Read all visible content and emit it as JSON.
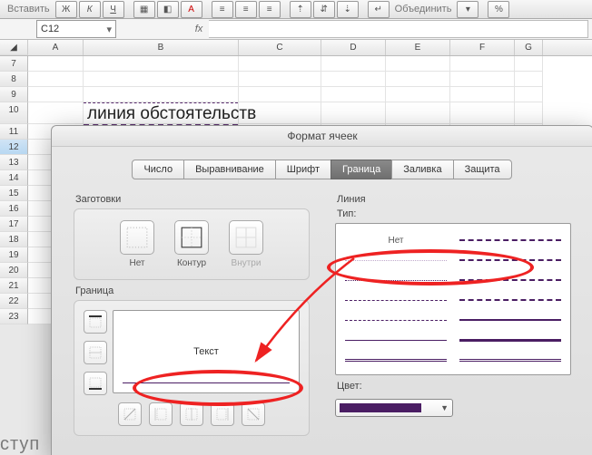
{
  "toolbar": {
    "insert_label": "Вставить",
    "merge_label": "Объединить"
  },
  "formula_bar": {
    "cell_ref": "C12",
    "fx_label": "fx"
  },
  "columns": [
    "A",
    "B",
    "C",
    "D",
    "E",
    "F",
    "G"
  ],
  "rows": [
    "7",
    "8",
    "9",
    "10",
    "11",
    "12",
    "13",
    "14",
    "15",
    "16",
    "17",
    "18",
    "19",
    "20",
    "21",
    "22",
    "23"
  ],
  "cell_b10": "линия обстоятельств",
  "dialog": {
    "title": "Формат ячеек",
    "tabs": {
      "number": "Число",
      "alignment": "Выравнивание",
      "font": "Шрифт",
      "border": "Граница",
      "fill": "Заливка",
      "protection": "Защита"
    },
    "presets_label": "Заготовки",
    "preset_none": "Нет",
    "preset_outline": "Контур",
    "preset_inside": "Внутри",
    "border_label": "Граница",
    "preview_text": "Текст",
    "line_label": "Линия",
    "line_type_label": "Тип:",
    "line_none": "Нет",
    "color_label": "Цвет:",
    "color_value": "#4a1d63"
  },
  "footer_text": "ступ",
  "chart_data": null
}
